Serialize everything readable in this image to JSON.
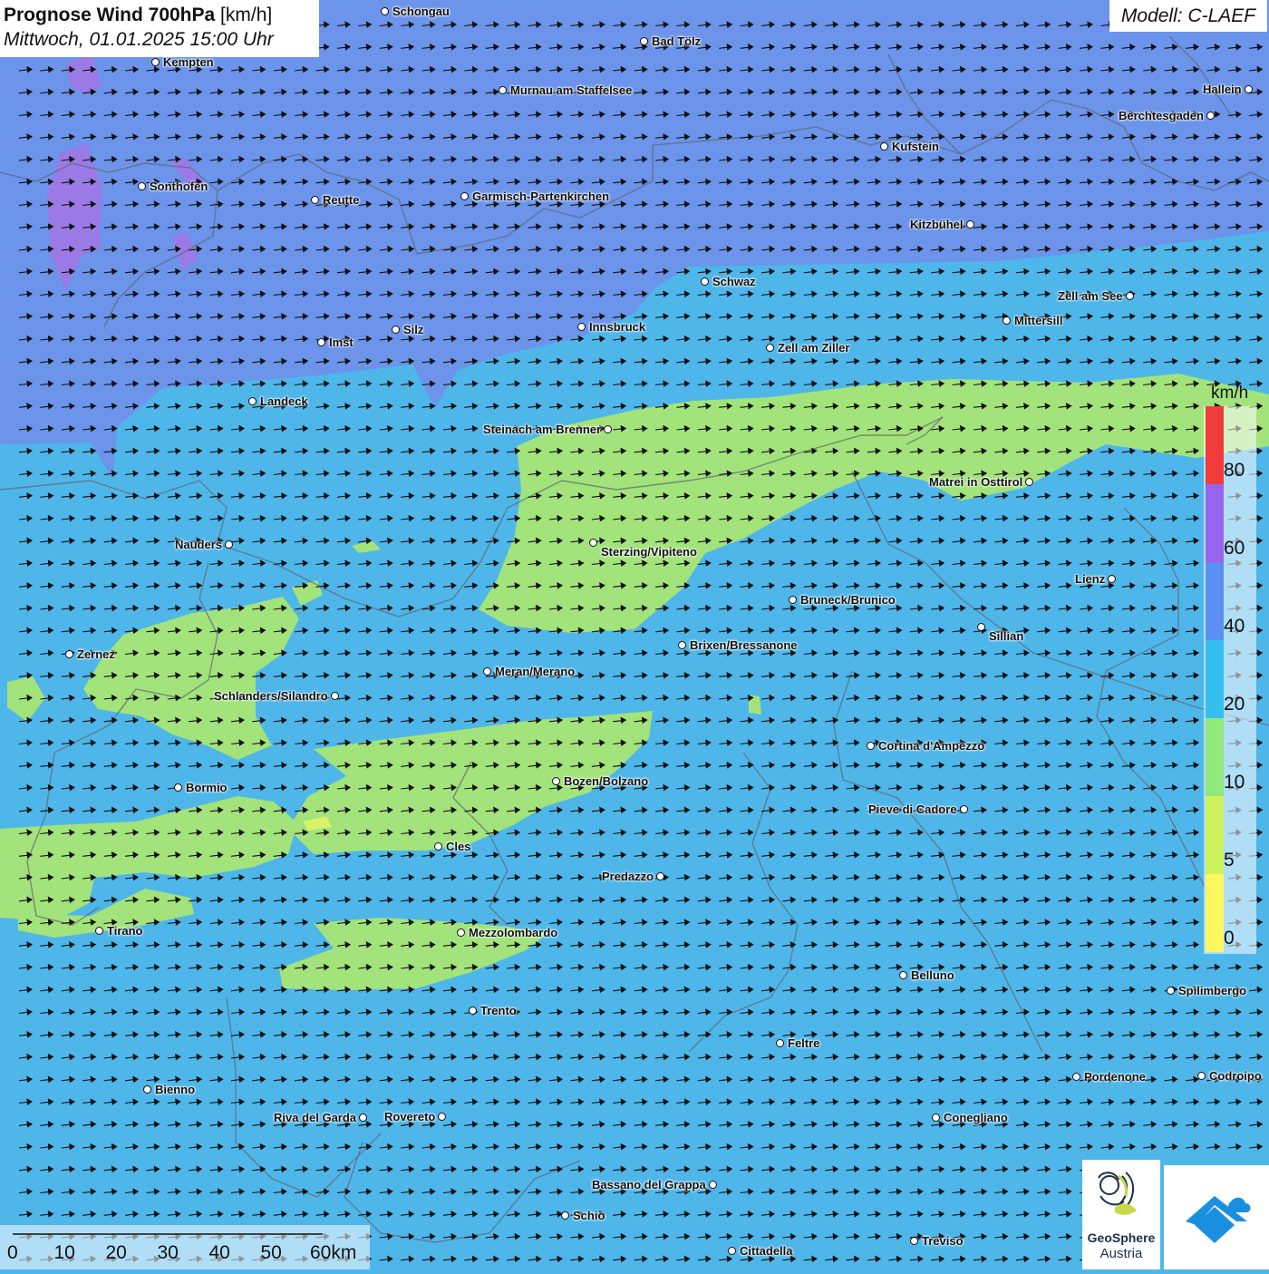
{
  "header": {
    "title_bold": "Prognose Wind 700hPa",
    "title_unit": "[km/h]",
    "datetime": "Mittwoch, 01.01.2025 15:00 Uhr",
    "model": "Modell: C-LAEF"
  },
  "legend": {
    "unit": "km/h",
    "classes": [
      {
        "label": "0",
        "color": "#fdf85e"
      },
      {
        "label": "5",
        "color": "#cdf25c"
      },
      {
        "label": "10",
        "color": "#91e87c"
      },
      {
        "label": "20",
        "color": "#35bfee"
      },
      {
        "label": "40",
        "color": "#5b8ff2"
      },
      {
        "label": "60",
        "color": "#9664ee"
      },
      {
        "label": "80",
        "color": "#f23c3c"
      }
    ]
  },
  "scale_bar": {
    "labels": [
      "0",
      "10",
      "20",
      "30",
      "40",
      "50",
      "60km"
    ]
  },
  "wind": {
    "direction": "east",
    "icon": "arrow-right-icon"
  },
  "cities": [
    {
      "name": "Schongau"
    },
    {
      "name": "Bad Tölz"
    },
    {
      "name": "Kempten"
    },
    {
      "name": "Murnau am Staffelsee"
    },
    {
      "name": "Hallein"
    },
    {
      "name": "Berchtesgaden"
    },
    {
      "name": "Kufstein"
    },
    {
      "name": "Sonthofen"
    },
    {
      "name": "Reutte"
    },
    {
      "name": "Garmisch-Partenkirchen"
    },
    {
      "name": "Kitzbühel"
    },
    {
      "name": "Schwaz"
    },
    {
      "name": "Zell am See"
    },
    {
      "name": "Mittersill"
    },
    {
      "name": "Innsbruck"
    },
    {
      "name": "Silz"
    },
    {
      "name": "Imst"
    },
    {
      "name": "Zell am Ziller"
    },
    {
      "name": "Landeck"
    },
    {
      "name": "Steinach am Brenner"
    },
    {
      "name": "Matrei in Osttirol"
    },
    {
      "name": "Nauders"
    },
    {
      "name": "Sterzing/Vipiteno"
    },
    {
      "name": "Lienz"
    },
    {
      "name": "Bruneck/Brunico"
    },
    {
      "name": "Sillian"
    },
    {
      "name": "Brixen/Bressanone"
    },
    {
      "name": "Zernez"
    },
    {
      "name": "Meran/Merano"
    },
    {
      "name": "Schlanders/Silandro"
    },
    {
      "name": "Cortina d'Ampezzo"
    },
    {
      "name": "Bozen/Bolzano"
    },
    {
      "name": "Bormio"
    },
    {
      "name": "Pieve di Cadore"
    },
    {
      "name": "Cles"
    },
    {
      "name": "Predazzo"
    },
    {
      "name": "Tirano"
    },
    {
      "name": "Mezzolombardo"
    },
    {
      "name": "Belluno"
    },
    {
      "name": "Spilimbergo"
    },
    {
      "name": "Trento"
    },
    {
      "name": "Feltre"
    },
    {
      "name": "Pordenone"
    },
    {
      "name": "Codroipo"
    },
    {
      "name": "Bienno"
    },
    {
      "name": "Riva del Garda"
    },
    {
      "name": "Rovereto"
    },
    {
      "name": "Conegliano"
    },
    {
      "name": "Bassano del Grappa"
    },
    {
      "name": "Schio"
    },
    {
      "name": "Treviso"
    },
    {
      "name": "Cittadella"
    }
  ],
  "logos": {
    "geosphere_name": "GeoSphere",
    "geosphere_sub": "Austria"
  }
}
